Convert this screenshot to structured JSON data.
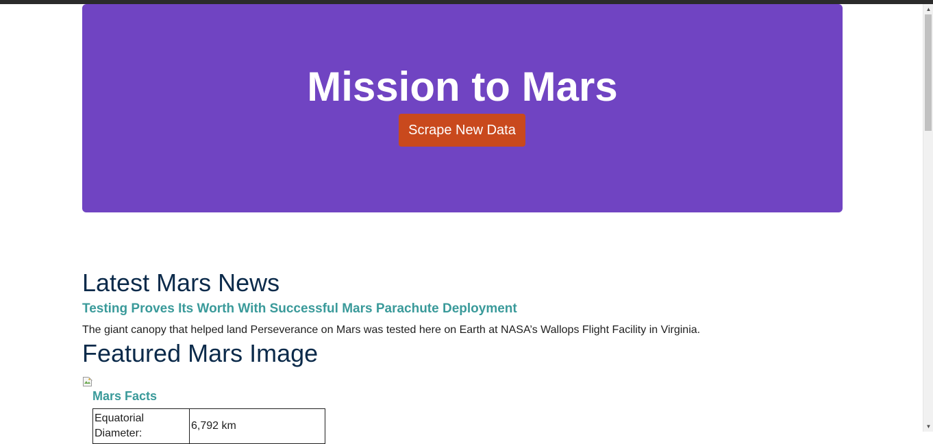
{
  "hero": {
    "title": "Mission to Mars",
    "button_label": "Scrape New Data"
  },
  "news": {
    "heading": "Latest Mars News",
    "title": "Testing Proves Its Worth With Successful Mars Parachute Deployment",
    "paragraph": "The giant canopy that helped land Perseverance on Mars was tested here on Earth at NASA’s Wallops Flight Facility in Virginia."
  },
  "featured_image": {
    "heading": "Featured Mars Image",
    "icon": "broken-image-icon"
  },
  "facts": {
    "heading": "Mars Facts",
    "rows": [
      {
        "label": "Equatorial Diameter:",
        "value": "6,792 km"
      }
    ]
  },
  "colors": {
    "hero_bg": "#7044c2",
    "button_bg": "#c9491d",
    "heading": "#0b2a4a",
    "link": "#3a9a9a"
  },
  "scrollbar": {
    "up_icon": "scroll-up-arrow-icon",
    "down_icon": "scroll-down-arrow-icon"
  }
}
